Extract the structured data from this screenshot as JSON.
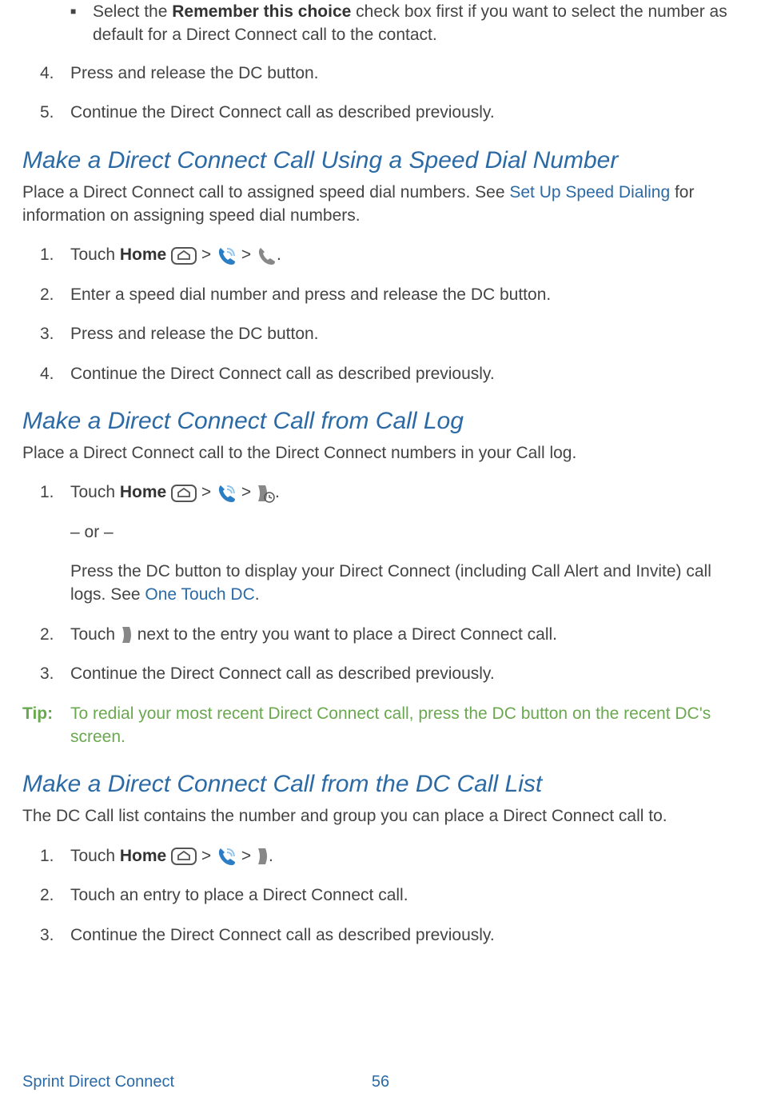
{
  "top": {
    "bullet_pre": "Select the ",
    "bullet_bold": "Remember this choice",
    "bullet_post": " check box first if you want to select the number as default for a Direct Connect call to the contact.",
    "step4_num": "4.",
    "step4": "Press and release the DC button.",
    "step5_num": "5.",
    "step5": "Continue the Direct Connect call as described previously."
  },
  "section1": {
    "heading": "Make a Direct Connect Call Using a Speed Dial Number",
    "intro_pre": "Place a Direct Connect call to assigned speed dial numbers. See ",
    "intro_link": "Set Up Speed Dialing",
    "intro_post": " for information on assigning speed dial numbers.",
    "s1_num": "1.",
    "s1_pre": "Touch ",
    "s1_bold": "Home",
    "gt": " > ",
    "period": ".",
    "s2_num": "2.",
    "s2": "Enter a speed dial number and press and release the DC button.",
    "s3_num": "3.",
    "s3": "Press and release the DC button.",
    "s4_num": "4.",
    "s4": "Continue the Direct Connect call as described previously."
  },
  "section2": {
    "heading": "Make a Direct Connect Call from Call Log",
    "intro": "Place a Direct Connect call to the Direct Connect numbers in your Call log.",
    "s1_num": "1.",
    "s1_pre": "Touch ",
    "s1_bold": "Home",
    "gt": " > ",
    "period": ".",
    "or": "– or –",
    "s1b_pre": "Press the DC button to display your Direct Connect (including Call Alert and Invite) call logs. See ",
    "s1b_link": "One Touch DC",
    "s1b_post": ".",
    "s2_num": "2.",
    "s2_pre": "Touch ",
    "s2_post": " next to the entry you want to place a Direct Connect call.",
    "s3_num": "3.",
    "s3": "Continue the Direct Connect call as described previously."
  },
  "tip": {
    "label": "Tip:",
    "text": "To redial your most recent Direct Connect call, press the DC button on the recent DC's screen."
  },
  "section3": {
    "heading": "Make a Direct Connect Call from the DC Call List",
    "intro": "The DC Call list contains the number and group you can place a Direct Connect call to.",
    "s1_num": "1.",
    "s1_pre": "Touch ",
    "s1_bold": "Home",
    "gt": " > ",
    "period": ".",
    "s2_num": "2.",
    "s2": "Touch an entry to place a Direct Connect call.",
    "s3_num": "3.",
    "s3": "Continue the Direct Connect call as described previously."
  },
  "footer": {
    "title": "Sprint Direct Connect",
    "page": "56"
  }
}
